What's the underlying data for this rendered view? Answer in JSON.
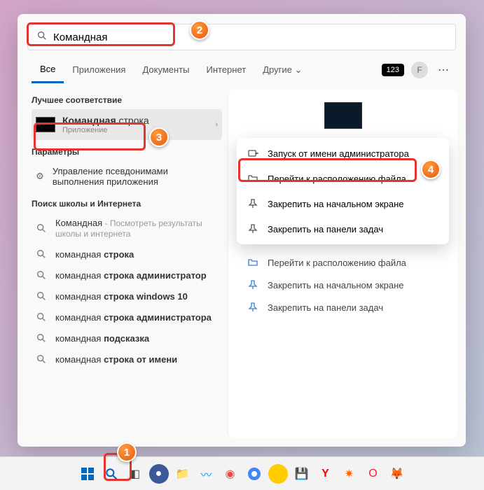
{
  "search": {
    "value": "Командная",
    "placeholder": ""
  },
  "tabs": {
    "all": "Все",
    "apps": "Приложения",
    "docs": "Документы",
    "web": "Интернет",
    "more": "Другие",
    "badge": "123",
    "avatar": "F"
  },
  "sections": {
    "best": "Лучшее соответствие",
    "params": "Параметры",
    "school": "Поиск школы и Интернета"
  },
  "best_match": {
    "title_bold": "Командная",
    "title_rest": " строка",
    "subtitle": "Приложение"
  },
  "param_item": "Управление псевдонимами выполнения приложения",
  "suggestions": [
    {
      "bold": "Командная",
      "rest": "",
      "hint": " - Посмотреть результаты школы и интернета"
    },
    {
      "bold": "командная",
      "rest": " строка",
      "hint": ""
    },
    {
      "bold": "командная",
      "rest": " строка администратор",
      "hint": ""
    },
    {
      "bold": "командная",
      "rest": " строка windows 10",
      "hint": ""
    },
    {
      "bold": "командная",
      "rest": " строка администратора",
      "hint": ""
    },
    {
      "bold": "командная",
      "rest": " подсказка",
      "hint": ""
    },
    {
      "bold": "командная",
      "rest": " строка от имени",
      "hint": ""
    }
  ],
  "context_menu": [
    {
      "icon": "admin",
      "label": "Запуск от имени администратора"
    },
    {
      "icon": "folder",
      "label": "Перейти к расположению файла"
    },
    {
      "icon": "pin",
      "label": "Закрепить на начальном экране"
    },
    {
      "icon": "pin",
      "label": "Закрепить на панели задач"
    }
  ],
  "secondary_actions": [
    {
      "icon": "folder",
      "label": "Перейти к расположению файла"
    },
    {
      "icon": "pin",
      "label": "Закрепить на начальном экране"
    },
    {
      "icon": "pin",
      "label": "Закрепить на панели задач"
    }
  ],
  "annotations": {
    "a1": "1",
    "a2": "2",
    "a3": "3",
    "a4": "4"
  }
}
